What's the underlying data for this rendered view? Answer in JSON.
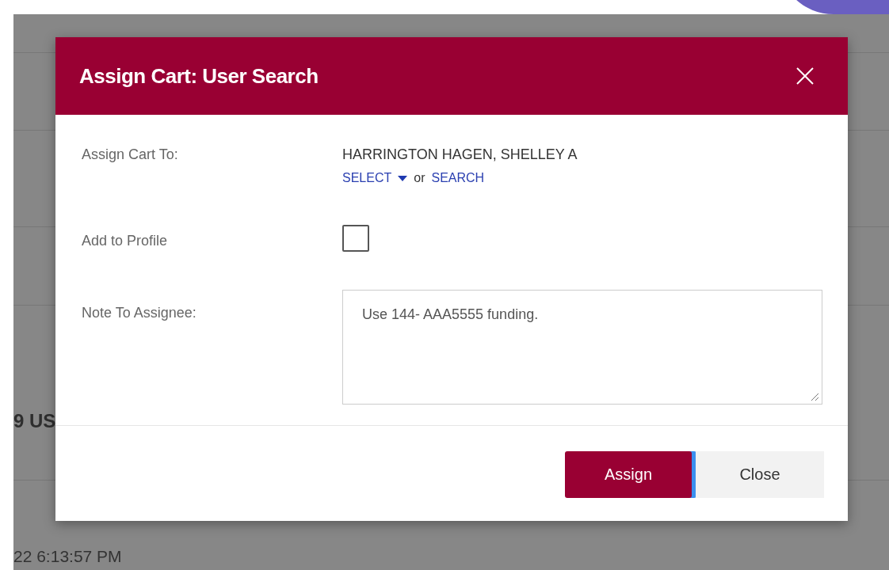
{
  "background": {
    "fragments": [
      "9 US",
      "22 6:13:57 PM"
    ]
  },
  "dialog": {
    "title": "Assign Cart: User Search",
    "assign_to": {
      "label": "Assign Cart To:",
      "value": "HARRINGTON HAGEN, SHELLEY A",
      "select_link": "SELECT",
      "or": "or",
      "search_link": "SEARCH"
    },
    "add_to_profile": {
      "label": "Add to Profile",
      "checked": false
    },
    "note": {
      "label": "Note To Assignee:",
      "value": "Use 144- AAA5555 funding."
    },
    "buttons": [
      {
        "label": "Assign",
        "kind": "primary",
        "focused": true
      },
      {
        "label": "Close",
        "kind": "secondary",
        "focused": false
      }
    ]
  }
}
